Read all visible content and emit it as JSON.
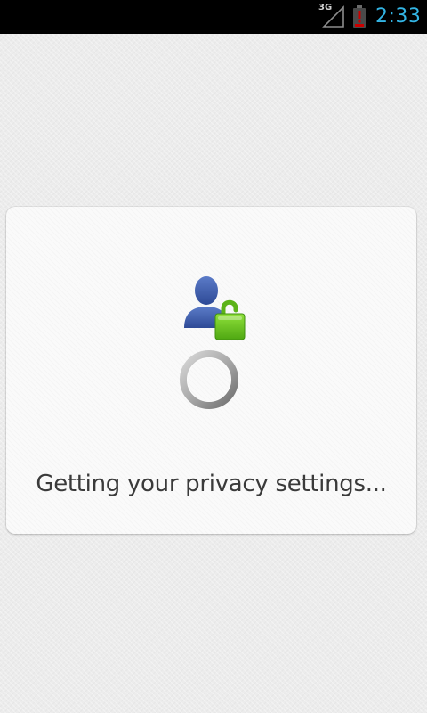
{
  "status_bar": {
    "network_type": "3G",
    "time": "2:33",
    "icons": [
      "signal-icon",
      "battery-low-icon"
    ],
    "clock_color": "#33b5e5",
    "battery_warning_color": "#cc0000"
  },
  "dialog": {
    "message": "Getting your privacy settings...",
    "icons": [
      "privacy-user-lock-icon",
      "loading-spinner"
    ],
    "colors": {
      "user_icon": "#3b5998",
      "lock_icon": "#6ec81e"
    }
  }
}
